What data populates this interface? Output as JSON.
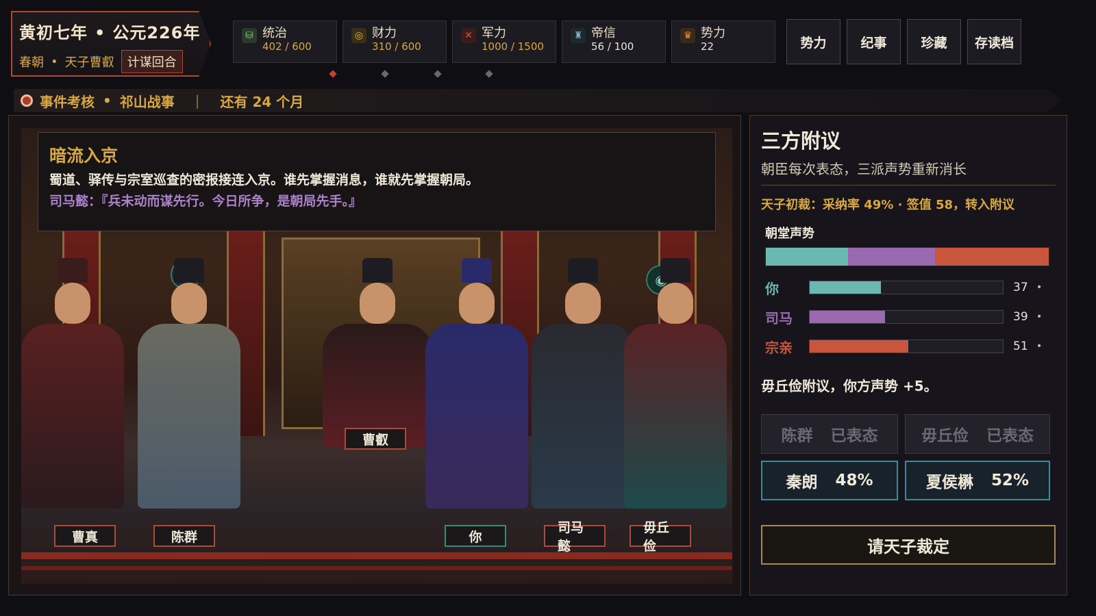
{
  "header": {
    "era": "黄初七年",
    "year": "公元226年",
    "season": "春朝",
    "role": "天子曹叡",
    "phase": "计谋回合"
  },
  "stats": [
    {
      "name": "统治",
      "value": "402 / 600",
      "icon": "governance-icon",
      "color": "#d9a843"
    },
    {
      "name": "财力",
      "value": "310 / 600",
      "icon": "coins-icon",
      "color": "#d9a843"
    },
    {
      "name": "军力",
      "value": "1000 / 1500",
      "icon": "crossed-swords-icon",
      "color": "#d9a843"
    },
    {
      "name": "帝信",
      "value": "56 / 100",
      "icon": "trust-icon",
      "color": "#e8e4da"
    },
    {
      "name": "势力",
      "value": "22",
      "icon": "power-icon",
      "color": "#e8e4da"
    }
  ],
  "menu": [
    "势力",
    "纪事",
    "珍藏",
    "存读档"
  ],
  "banner": {
    "label": "事件考核",
    "event": "祁山战事",
    "remaining": "还有 24 个月"
  },
  "event": {
    "title": "暗流入京",
    "body": "蜀道、驿传与宗室巡查的密报接连入京。谁先掌握消息，谁就先掌握朝局。",
    "quote": "司马懿：『兵未动而谋先行。今日所争，是朝局先手。』"
  },
  "characters": [
    "曹真",
    "陈群",
    "曹叡",
    "你",
    "司马懿",
    "毋丘俭"
  ],
  "panel": {
    "title": "三方附议",
    "subtitle": "朝臣每次表态，三派声势重新消长",
    "verdict": "天子初裁：采纳率 49% · 签值 58，转入附议",
    "momentum_label": "朝堂声势",
    "note": "毋丘俭附议，你方声势 +5。",
    "decide_label": "请天子裁定"
  },
  "factions": [
    {
      "name": "你",
      "value": 37,
      "color": "#6ab8b0",
      "bullet": "•"
    },
    {
      "name": "司马",
      "value": 39,
      "color": "#9a6ab0",
      "bullet": "•"
    },
    {
      "name": "宗亲",
      "value": 51,
      "color": "#c8553c",
      "bullet": "•"
    }
  ],
  "votes": [
    {
      "name": "陈群",
      "status": "已表态",
      "state": "done"
    },
    {
      "name": "毋丘俭",
      "status": "已表态",
      "state": "done"
    },
    {
      "name": "秦朗",
      "status": "48%",
      "state": "open"
    },
    {
      "name": "夏侯楙",
      "status": "52%",
      "state": "open"
    }
  ]
}
